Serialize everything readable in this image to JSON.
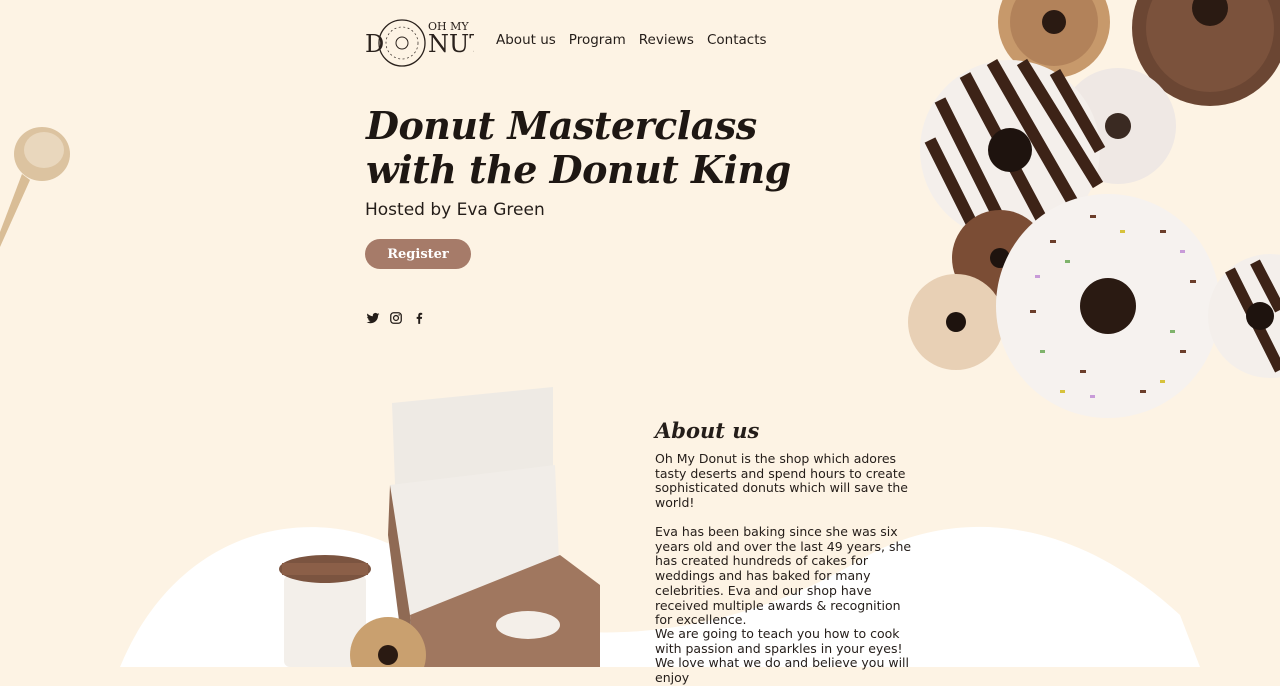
{
  "header": {
    "logo_alt": "Oh My Donut",
    "nav": [
      "About us",
      "Program",
      "Reviews",
      "Contacts"
    ]
  },
  "hero": {
    "title_line1": "Donut Masterclass",
    "title_line2": "with the Donut King",
    "host": "Hosted by Eva Green",
    "register_label": "Register"
  },
  "social": [
    "twitter-icon",
    "instagram-icon",
    "facebook-icon"
  ],
  "about": {
    "title": "About us",
    "p1": "Oh My Donut is the shop which adores tasty deserts and spend hours to create sophisticated donuts which will save the world!",
    "p2": "Eva has been baking since she was six years old and over the last 49 years, she has created hundreds of cakes for weddings and has baked for many celebrities. Eva and our shop have received multiple awards & recognition for excellence.",
    "p3": "We are going to teach you how to cook with passion and sparkles in your eyes! We love what we do and believe you will enjoy"
  },
  "colors": {
    "background": "#fdf3e4",
    "accent": "#a67b69",
    "chocolate": "#6b4633",
    "text": "#241d19"
  }
}
